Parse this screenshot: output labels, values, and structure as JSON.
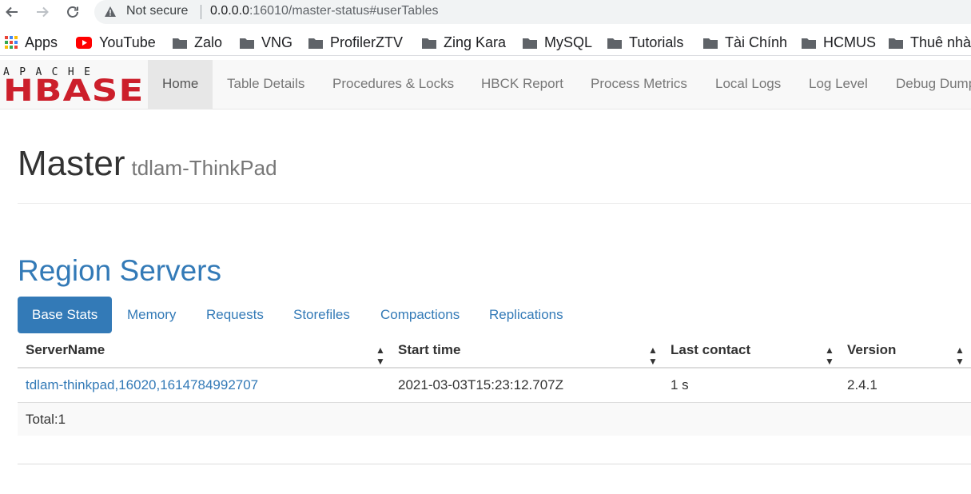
{
  "browser": {
    "security_label": "Not secure",
    "url_host": "0.0.0.0",
    "url_rest": ":16010/master-status#userTables"
  },
  "bookmarks": [
    {
      "label": "Apps",
      "icon": "apps-grid-icon"
    },
    {
      "label": "YouTube",
      "icon": "youtube-icon"
    },
    {
      "label": "Zalo",
      "icon": "folder-icon"
    },
    {
      "label": "VNG",
      "icon": "folder-icon"
    },
    {
      "label": "ProfilerZTV",
      "icon": "folder-icon"
    },
    {
      "label": "Zing Kara",
      "icon": "folder-icon"
    },
    {
      "label": "MySQL",
      "icon": "folder-icon"
    },
    {
      "label": "Tutorials",
      "icon": "folder-icon"
    },
    {
      "label": "Tài Chính",
      "icon": "folder-icon"
    },
    {
      "label": "HCMUS",
      "icon": "folder-icon"
    },
    {
      "label": "Thuê nhà",
      "icon": "folder-icon"
    }
  ],
  "logo": {
    "top": "APACHE",
    "main": "HBASE"
  },
  "nav": [
    {
      "label": "Home",
      "active": true
    },
    {
      "label": "Table Details"
    },
    {
      "label": "Procedures & Locks"
    },
    {
      "label": "HBCK Report"
    },
    {
      "label": "Process Metrics"
    },
    {
      "label": "Local Logs"
    },
    {
      "label": "Log Level"
    },
    {
      "label": "Debug Dump"
    }
  ],
  "page": {
    "title": "Master",
    "subtitle": "tdlam-ThinkPad"
  },
  "region_servers": {
    "heading": "Region Servers",
    "tabs": [
      {
        "label": "Base Stats",
        "active": true
      },
      {
        "label": "Memory"
      },
      {
        "label": "Requests"
      },
      {
        "label": "Storefiles"
      },
      {
        "label": "Compactions"
      },
      {
        "label": "Replications"
      }
    ],
    "columns": [
      "ServerName",
      "Start time",
      "Last contact",
      "Version"
    ],
    "rows": [
      {
        "server_name": "tdlam-thinkpad,16020,1614784992707",
        "start_time": "2021-03-03T15:23:12.707Z",
        "last_contact": "1 s",
        "version": "2.4.1"
      }
    ],
    "total": "Total:1"
  },
  "colors": {
    "accent": "#337ab7",
    "logo_red": "#cc1f2b"
  }
}
